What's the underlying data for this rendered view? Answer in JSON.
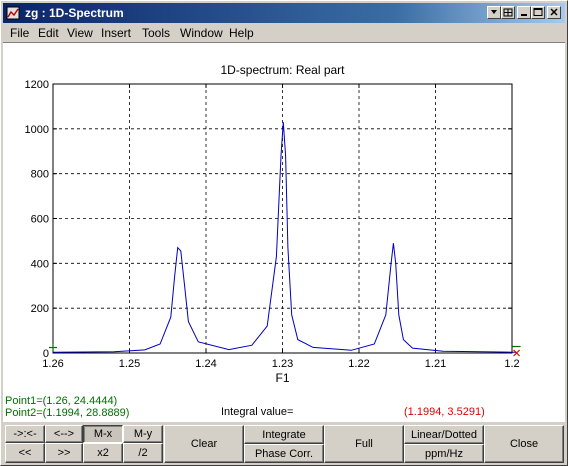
{
  "window": {
    "title": "zg : 1D-Spectrum"
  },
  "menu": [
    "File",
    "Edit",
    "View",
    "Insert",
    "Tools",
    "Window",
    "Help"
  ],
  "chart_data": {
    "type": "line",
    "title": "1D-spectrum: Real part",
    "xlabel": "F1",
    "ylabel": "",
    "xlim": [
      1.26,
      1.2
    ],
    "ylim": [
      0,
      1200
    ],
    "x_reversed": true,
    "grid": true,
    "xticks": [
      "1.26",
      "1.25",
      "1.24",
      "1.23",
      "1.22",
      "1.21",
      "1.2"
    ],
    "yticks": [
      "0",
      "200",
      "400",
      "600",
      "800",
      "1000",
      "1200"
    ],
    "series": [
      {
        "color": "#0000c0",
        "x": [
          1.26,
          1.252,
          1.248,
          1.246,
          1.2446,
          1.2441,
          1.2437,
          1.2433,
          1.2428,
          1.2423,
          1.241,
          1.237,
          1.234,
          1.232,
          1.2308,
          1.2302,
          1.2299,
          1.2296,
          1.2293,
          1.2288,
          1.228,
          1.226,
          1.221,
          1.218,
          1.2165,
          1.2158,
          1.2155,
          1.2152,
          1.2148,
          1.2142,
          1.213,
          1.209,
          1.2,
          1.1994
        ],
        "y": [
          3,
          6,
          14,
          40,
          160,
          340,
          470,
          455,
          300,
          140,
          50,
          15,
          35,
          120,
          430,
          880,
          1030,
          880,
          470,
          170,
          60,
          25,
          12,
          40,
          170,
          400,
          490,
          400,
          170,
          60,
          22,
          8,
          3.5,
          3.5
        ]
      }
    ]
  },
  "cursor_markers": {
    "left_color": "#007000",
    "right_color": "#e00000"
  },
  "info": {
    "point1": "Point1=(1.26, 24.4444)",
    "point2": "Point2=(1.1994, 28.8889)",
    "integral_label": "Integral value=",
    "integral_value": "(1.1994, 3.5291)"
  },
  "buttons": {
    "shift_left": "->:<-",
    "shift_right": "<-->",
    "mx": "M-x",
    "my": "M-y",
    "prev": "<<",
    "next": ">>",
    "x2": "x2",
    "div2": "/2",
    "clear": "Clear",
    "integrate": "Integrate",
    "phase_corr": "Phase Corr.",
    "full": "Full",
    "linear_dotted": "Linear/Dotted",
    "ppm_hz": "ppm/Hz",
    "close": "Close"
  }
}
